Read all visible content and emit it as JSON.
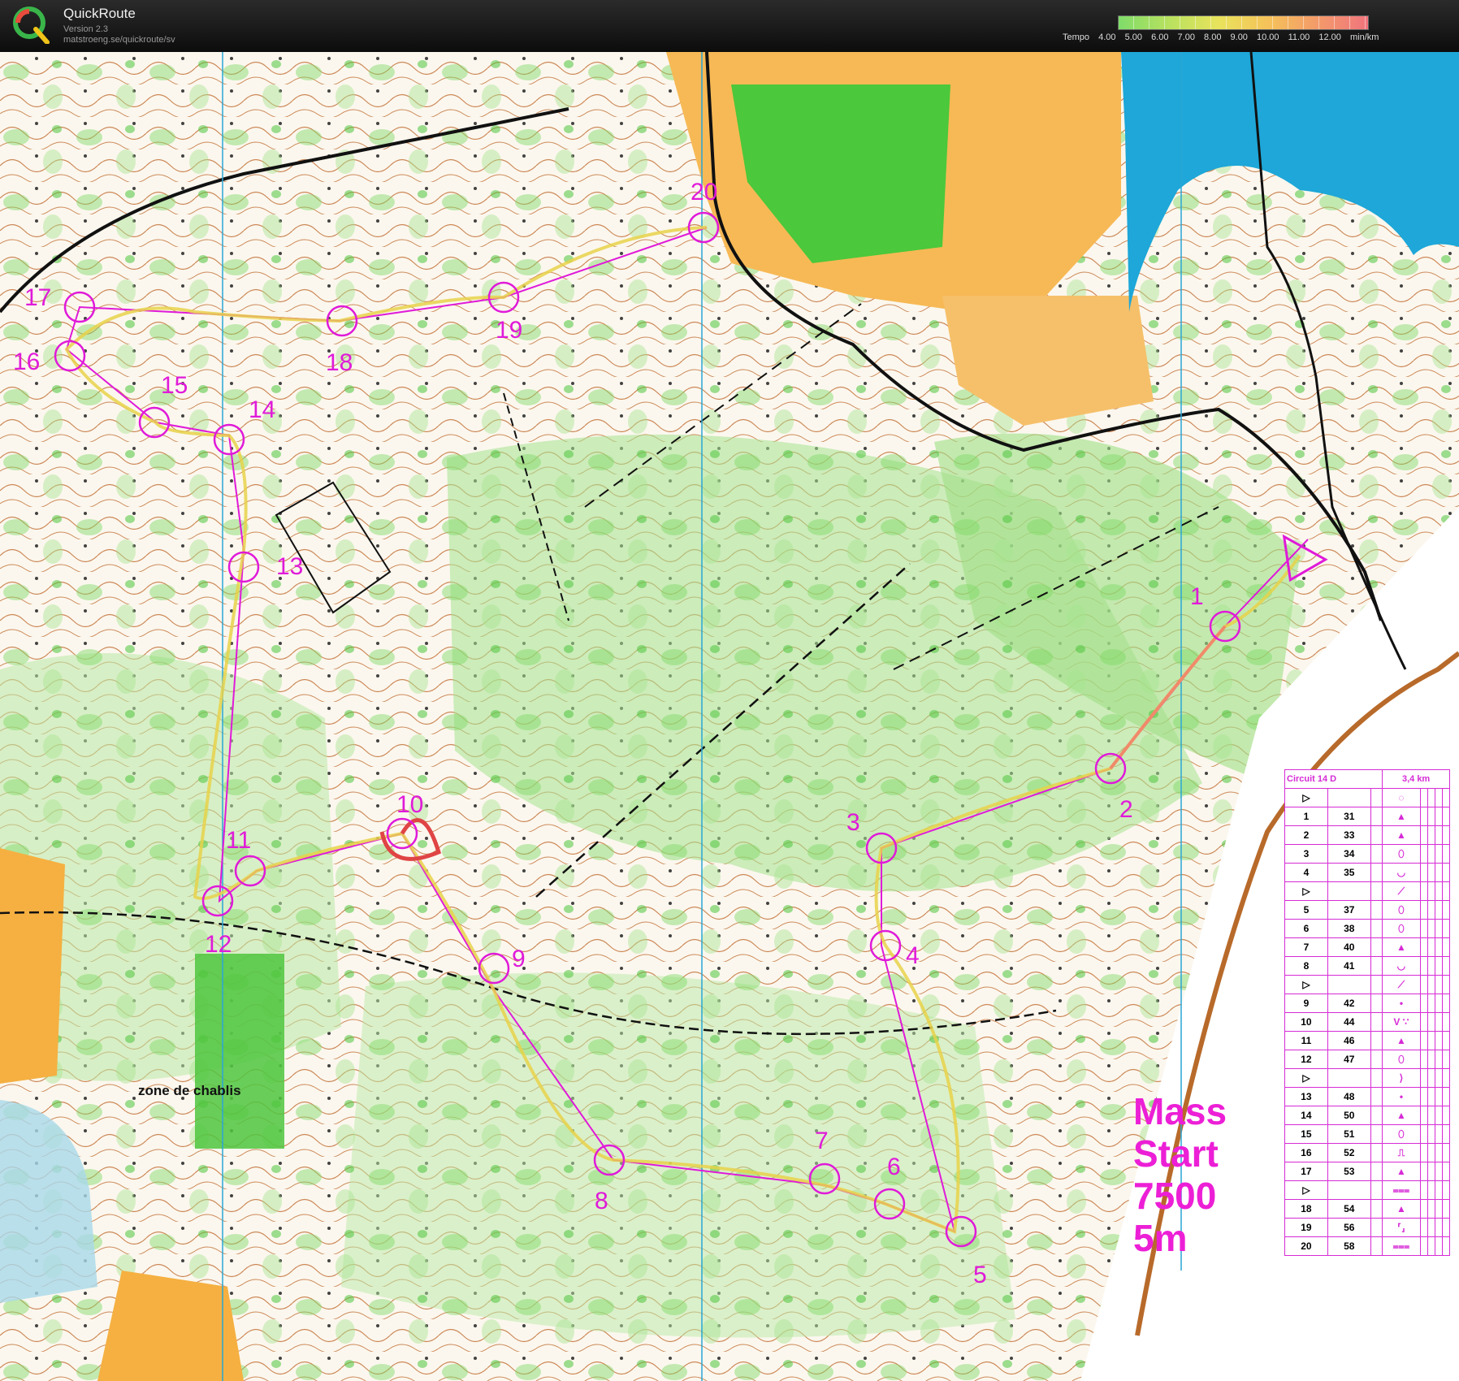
{
  "app": {
    "title": "QuickRoute",
    "version": "Version 2.3",
    "url": "matstroeng.se/quickroute/sv"
  },
  "tempo": {
    "label": "Tempo",
    "values": [
      "4.00",
      "5.00",
      "6.00",
      "7.00",
      "8.00",
      "9.00",
      "10.00",
      "11.00",
      "12.00"
    ],
    "unit": "min/km"
  },
  "map": {
    "area_label": "zone de chablis",
    "mass_start": [
      "Mass",
      "Start",
      "7500",
      "5m"
    ],
    "controls": [
      {
        "num": "1"
      },
      {
        "num": "2"
      },
      {
        "num": "3"
      },
      {
        "num": "4"
      },
      {
        "num": "5"
      },
      {
        "num": "6"
      },
      {
        "num": "7"
      },
      {
        "num": "8"
      },
      {
        "num": "9"
      },
      {
        "num": "10"
      },
      {
        "num": "11"
      },
      {
        "num": "12"
      },
      {
        "num": "13"
      },
      {
        "num": "14"
      },
      {
        "num": "15"
      },
      {
        "num": "16"
      },
      {
        "num": "17"
      },
      {
        "num": "18"
      },
      {
        "num": "19"
      },
      {
        "num": "20"
      }
    ]
  },
  "description_sheet": {
    "title": "Circuit 14 D",
    "length": "3,4 km",
    "rows": [
      {
        "n": "▷",
        "code": "",
        "sym": "◌"
      },
      {
        "n": "1",
        "code": "31",
        "sym": "▲"
      },
      {
        "n": "2",
        "code": "33",
        "sym": "▲"
      },
      {
        "n": "3",
        "code": "34",
        "sym": "⬯"
      },
      {
        "n": "4",
        "code": "35",
        "sym": "◡"
      },
      {
        "n": "▷",
        "code": "",
        "sym": "⟋"
      },
      {
        "n": "5",
        "code": "37",
        "sym": "⬯"
      },
      {
        "n": "6",
        "code": "38",
        "sym": "⬯"
      },
      {
        "n": "7",
        "code": "40",
        "sym": "▲"
      },
      {
        "n": "8",
        "code": "41",
        "sym": "◡"
      },
      {
        "n": "▷",
        "code": "",
        "sym": "⟋"
      },
      {
        "n": "9",
        "code": "42",
        "sym": "•"
      },
      {
        "n": "10",
        "code": "44",
        "sym": "V ∵"
      },
      {
        "n": "11",
        "code": "46",
        "sym": "▲"
      },
      {
        "n": "12",
        "code": "47",
        "sym": "⬯"
      },
      {
        "n": "▷",
        "code": "",
        "sym": "⟩"
      },
      {
        "n": "13",
        "code": "48",
        "sym": "•"
      },
      {
        "n": "14",
        "code": "50",
        "sym": "▲"
      },
      {
        "n": "15",
        "code": "51",
        "sym": "⬯"
      },
      {
        "n": "16",
        "code": "52",
        "sym": "⎍"
      },
      {
        "n": "17",
        "code": "53",
        "sym": "▲"
      },
      {
        "n": "▷",
        "code": "",
        "sym": "⩶"
      },
      {
        "n": "18",
        "code": "54",
        "sym": "▲"
      },
      {
        "n": "19",
        "code": "56",
        "sym": "⸢⸥"
      },
      {
        "n": "20",
        "code": "58",
        "sym": "⩶"
      }
    ]
  },
  "colors": {
    "course": "#e01ad9",
    "route": "#e8d24a",
    "forest_green": "#6fd45a",
    "open_yellow": "#f5b041",
    "water": "#1ea7d8",
    "contour": "#b35a1f"
  }
}
